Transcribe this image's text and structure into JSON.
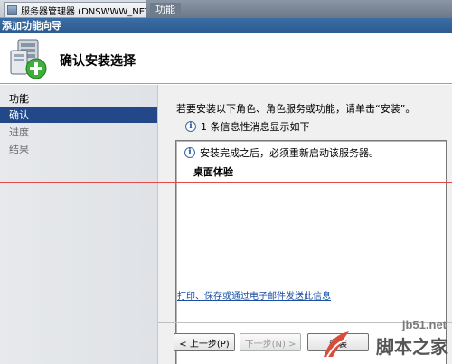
{
  "background_window": {
    "tab_label": "服务器管理器 (DNSWWW_NET)",
    "title": "功能"
  },
  "wizard": {
    "title": "添加功能向导",
    "heading": "确认安装选择",
    "icon": "server-add-icon"
  },
  "steps": [
    {
      "label": "功能",
      "state": "normal"
    },
    {
      "label": "确认",
      "state": "active"
    },
    {
      "label": "进度",
      "state": "dim"
    },
    {
      "label": "结果",
      "state": "dim"
    }
  ],
  "content": {
    "intro": "若要安装以下角色、角色服务或功能，请单击“安装”。",
    "info_message": "1 条信息性消息显示如下",
    "list": {
      "note": "安装完成之后，必须重新启动该服务器。",
      "items": [
        "桌面体验"
      ]
    },
    "link": "打印、保存或通过电子邮件发送此信息"
  },
  "buttons": {
    "prev": "< 上一步(P)",
    "next": "下一步(N) >",
    "install": "安装"
  },
  "watermark": {
    "url": "jb51.net",
    "name": "脚本之家"
  },
  "colors": {
    "titlebar": "#2b5a8e",
    "active_step": "#23488a",
    "link": "#1a4fa5"
  }
}
